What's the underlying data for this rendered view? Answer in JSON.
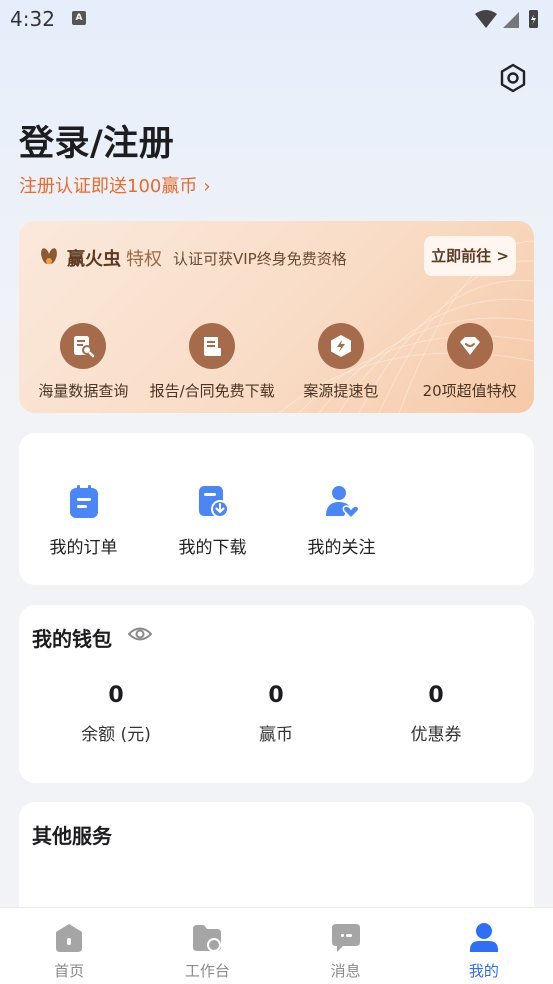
{
  "status_bar": {
    "time": "4:32",
    "notif_icon": "A"
  },
  "header": {
    "title": "登录/注册",
    "promo": "注册认证即送100赢币",
    "promo_chevron": "›"
  },
  "vip": {
    "brand": "赢火虫",
    "tag": "特权",
    "description": "认证可获VIP终身免费资格",
    "go_button": "立即前往 >",
    "items": [
      {
        "label": "海量数据查询",
        "icon": "data-search-icon"
      },
      {
        "label": "报告/合同免费下载",
        "icon": "document-download-icon"
      },
      {
        "label": "案源提速包",
        "icon": "lightning-hexagon-icon"
      },
      {
        "label": "20项超值特权",
        "icon": "diamond-icon"
      }
    ]
  },
  "quick_actions": [
    {
      "label": "我的订单",
      "icon": "order-icon"
    },
    {
      "label": "我的下载",
      "icon": "download-icon"
    },
    {
      "label": "我的关注",
      "icon": "follow-icon"
    }
  ],
  "wallet": {
    "title": "我的钱包",
    "stats": [
      {
        "value": "0",
        "label": "余额 (元)"
      },
      {
        "value": "0",
        "label": "赢币"
      },
      {
        "value": "0",
        "label": "优惠券"
      }
    ]
  },
  "other_services": {
    "title": "其他服务"
  },
  "tabbar": [
    {
      "label": "首页",
      "icon": "home-icon",
      "active": false
    },
    {
      "label": "工作台",
      "icon": "workspace-icon",
      "active": false
    },
    {
      "label": "消息",
      "icon": "message-icon",
      "active": false
    },
    {
      "label": "我的",
      "icon": "profile-icon",
      "active": true
    }
  ],
  "colors": {
    "accent": "#2f6ef6",
    "promo": "#ec6a2a",
    "vip_icon": "#a56b4b",
    "quick_icon": "#4b86f6"
  }
}
